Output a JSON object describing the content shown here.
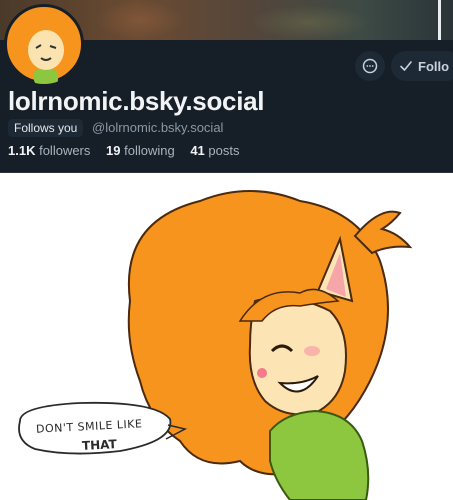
{
  "profile": {
    "display_handle": "lolrnomic.bsky.social",
    "follows_you_label": "Follows you",
    "handle": "@lolrnomic.bsky.social",
    "stats": {
      "followers_count": "1.1K",
      "followers_label": "followers",
      "following_count": "19",
      "following_label": "following",
      "posts_count": "41",
      "posts_label": "posts"
    }
  },
  "actions": {
    "message_icon": "message-circle-icon",
    "follow_icon": "check-icon",
    "follow_label": "Follo"
  },
  "post": {
    "speech_line1": "Don't smile like",
    "speech_line2": "THAT"
  },
  "colors": {
    "background": "#161e27",
    "button_bg": "#1e2936",
    "muted_text": "#8b98a5",
    "hair_orange": "#f7941d"
  }
}
